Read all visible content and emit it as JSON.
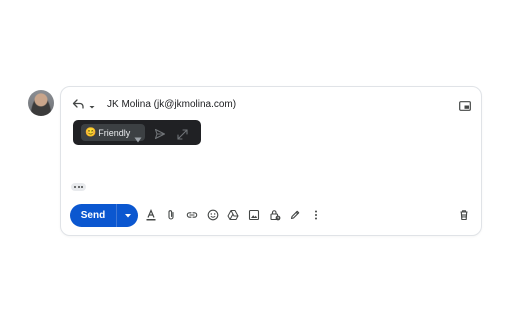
{
  "composer": {
    "recipient": "JK Molina (jk@jkmolina.com)",
    "tone": {
      "emoji": "😊",
      "label": "Friendly"
    },
    "send_label": "Send"
  },
  "colors": {
    "send_button": "#0b57d0",
    "tone_bar": "#202124",
    "icon": "#444746"
  },
  "icons": {
    "header": [
      "reply-icon",
      "chevron-down-icon",
      "pop-out-icon"
    ],
    "tone_bar": [
      "dropdown-caret-icon",
      "send-arrow-icon",
      "expand-icon"
    ],
    "toolbar": [
      "format-text-icon",
      "attach-icon",
      "link-icon",
      "emoji-icon",
      "drive-icon",
      "photo-icon",
      "confidential-lock-icon",
      "signature-pen-icon",
      "more-vert-icon",
      "trash-icon"
    ]
  }
}
